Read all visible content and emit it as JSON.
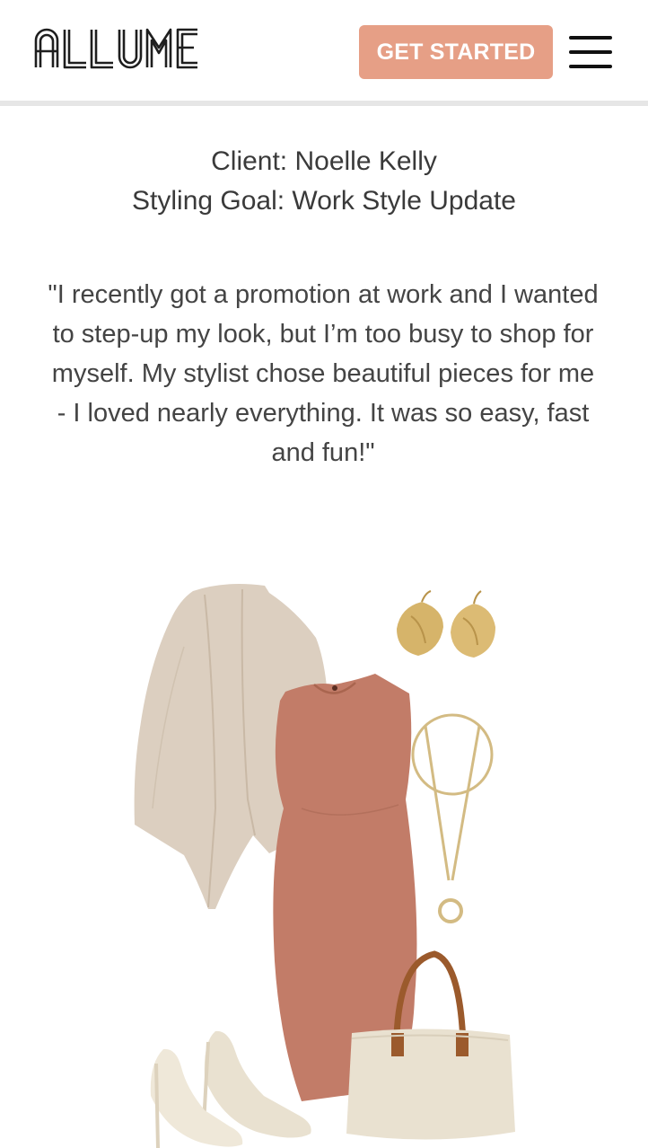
{
  "header": {
    "logo_text": "ALLUME",
    "cta_label": "GET STARTED",
    "menu_icon": "hamburger-menu-icon"
  },
  "testimonial": {
    "client_line": "Client: Noelle Kelly",
    "goal_line": "Styling Goal: Work Style Update",
    "quote": "\"I recently got a promotion at work and I wanted to step-up my look, but I’m too busy to shop for myself. My stylist chose beautiful pieces for me - I loved nearly everything. It was so easy, fast and fun!\""
  },
  "outfit": {
    "items": [
      "cardigan",
      "earrings",
      "dress",
      "pendant-necklace",
      "pumps",
      "tote-bag"
    ]
  },
  "colors": {
    "accent": "#e69f86",
    "text": "#333333",
    "dress": "#c27c68",
    "cardigan": "#dccfc0",
    "gold": "#d6b46a",
    "leather": "#9b5a2c",
    "cream": "#e9e1d0"
  }
}
